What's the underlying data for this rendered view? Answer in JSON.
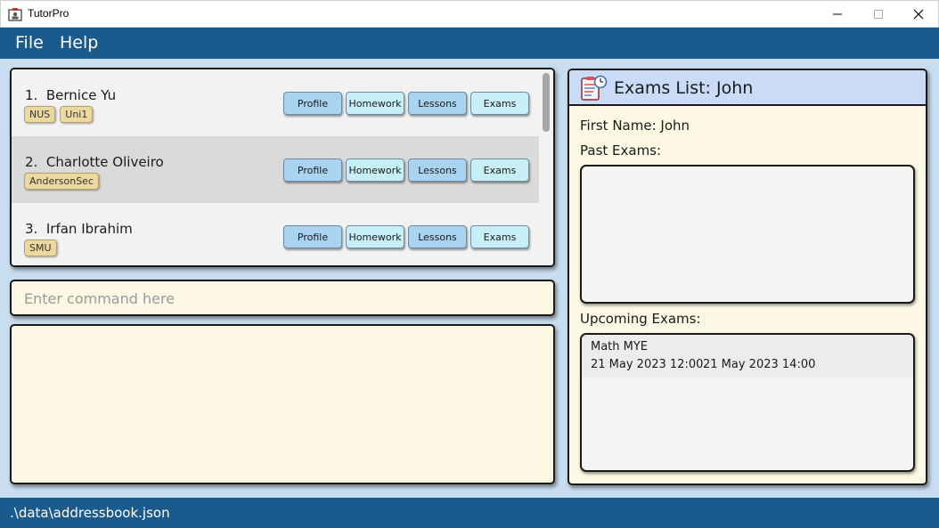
{
  "window": {
    "title": "TutorPro"
  },
  "menu": {
    "items": [
      "File",
      "Help"
    ]
  },
  "persons": [
    {
      "index": "1.",
      "name": "Bernice Yu",
      "tags": [
        "NUS",
        "Uni1"
      ]
    },
    {
      "index": "2.",
      "name": "Charlotte Oliveiro",
      "tags": [
        "AndersonSec"
      ]
    },
    {
      "index": "3.",
      "name": "Irfan Ibrahim",
      "tags": [
        "SMU"
      ]
    }
  ],
  "row_buttons": {
    "profile": "Profile",
    "homework": "Homework",
    "lessons": "Lessons",
    "exams": "Exams"
  },
  "command": {
    "placeholder": "Enter command here",
    "value": ""
  },
  "result": {
    "text": ""
  },
  "exams_panel": {
    "title": "Exams List: John",
    "first_name_label": "First Name: John",
    "past_label": "Past Exams:",
    "upcoming_label": "Upcoming Exams:",
    "upcoming": [
      {
        "name": "Math MYE",
        "start": "21 May 2023 12:00",
        "end": "21 May 2023 14:00"
      }
    ]
  },
  "status": {
    "path": ".\\data\\addressbook.json"
  },
  "colors": {
    "accent": "#1b5a8c",
    "background": "#c8ddef",
    "card": "#fdf8e4",
    "tag": "#ecd9a0",
    "button_blue": "#a9d3f0",
    "button_cyan": "#c8eef6"
  },
  "icons": {
    "app": "tutor-app-icon",
    "exam": "exam-clipboard-icon"
  }
}
